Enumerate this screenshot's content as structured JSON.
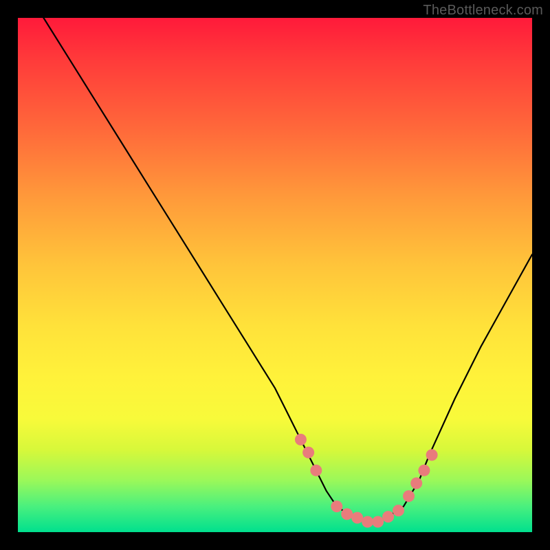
{
  "attribution": "TheBottleneck.com",
  "colors": {
    "page_bg": "#000000",
    "gradient_top": "#ff1a3a",
    "gradient_bottom": "#00e08e",
    "curve_stroke": "#000000",
    "marker_fill": "#e97c7c",
    "marker_stroke": "#c95a5a"
  },
  "chart_data": {
    "type": "line",
    "title": "",
    "xlabel": "",
    "ylabel": "",
    "xlim": [
      0,
      100
    ],
    "ylim": [
      0,
      100
    ],
    "grid": false,
    "legend": false,
    "series": [
      {
        "name": "bottleneck-curve",
        "x": [
          5,
          10,
          15,
          20,
          25,
          30,
          35,
          40,
          45,
          50,
          52,
          55,
          58,
          60,
          62,
          65,
          68,
          70,
          72,
          75,
          78,
          80,
          85,
          90,
          95,
          100
        ],
        "y": [
          100,
          92,
          84,
          76,
          68,
          60,
          52,
          44,
          36,
          28,
          24,
          18,
          12,
          8,
          5,
          3,
          2,
          2,
          3,
          5,
          10,
          15,
          26,
          36,
          45,
          54
        ]
      }
    ],
    "markers": {
      "name": "highlighted-points",
      "x": [
        55,
        56.5,
        58,
        62,
        64,
        66,
        68,
        70,
        72,
        74,
        76,
        77.5,
        79,
        80.5
      ],
      "y": [
        18,
        15.5,
        12,
        5,
        3.5,
        2.8,
        2,
        2,
        3,
        4.2,
        7,
        9.5,
        12,
        15
      ]
    }
  }
}
